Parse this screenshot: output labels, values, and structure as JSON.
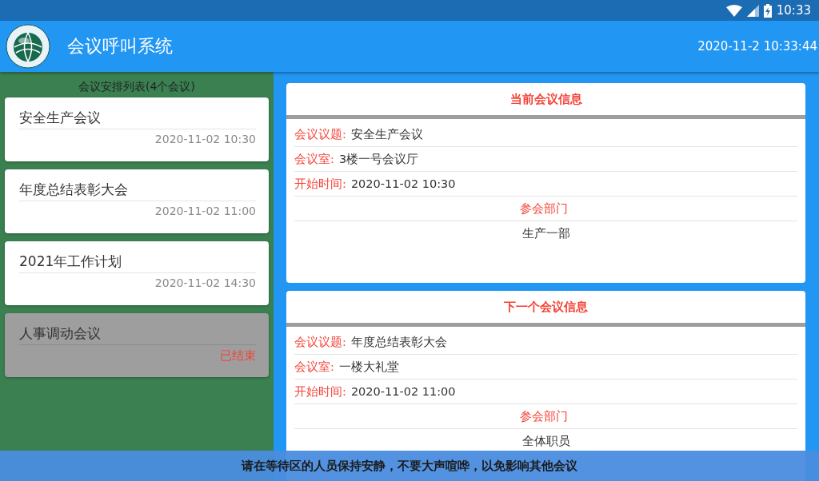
{
  "status_bar": {
    "time": "10:33"
  },
  "app_bar": {
    "title": "会议呼叫系统",
    "datetime": "2020-11-2 10:33:44"
  },
  "schedule": {
    "heading": "会议安排列表(4个会议)",
    "meetings": [
      {
        "title": "安全生产会议",
        "time": "2020-11-02 10:30",
        "ended": false
      },
      {
        "title": "年度总结表彰大会",
        "time": "2020-11-02 11:00",
        "ended": false
      },
      {
        "title": "2021年工作计划",
        "time": "2020-11-02 14:30",
        "ended": false
      },
      {
        "title": "人事调动会议",
        "time": "已结束",
        "ended": true
      }
    ]
  },
  "info_cards": [
    {
      "title": "当前会议信息",
      "fields": [
        {
          "label": "会议议题:",
          "value": "安全生产会议"
        },
        {
          "label": "会议室:",
          "value": "3楼一号会议厅"
        },
        {
          "label": "开始时间:",
          "value": "2020-11-02 10:30"
        }
      ],
      "departments_label": "参会部门",
      "departments": "生产一部"
    },
    {
      "title": "下一个会议信息",
      "fields": [
        {
          "label": "会议议题:",
          "value": "年度总结表彰大会"
        },
        {
          "label": "会议室:",
          "value": "一楼大礼堂"
        },
        {
          "label": "开始时间:",
          "value": "2020-11-02 11:00"
        }
      ],
      "departments_label": "参会部门",
      "departments": "全体职员"
    }
  ],
  "notice": "请在等待区的人员保持安静，不要大声喧哗，以免影响其他会议"
}
